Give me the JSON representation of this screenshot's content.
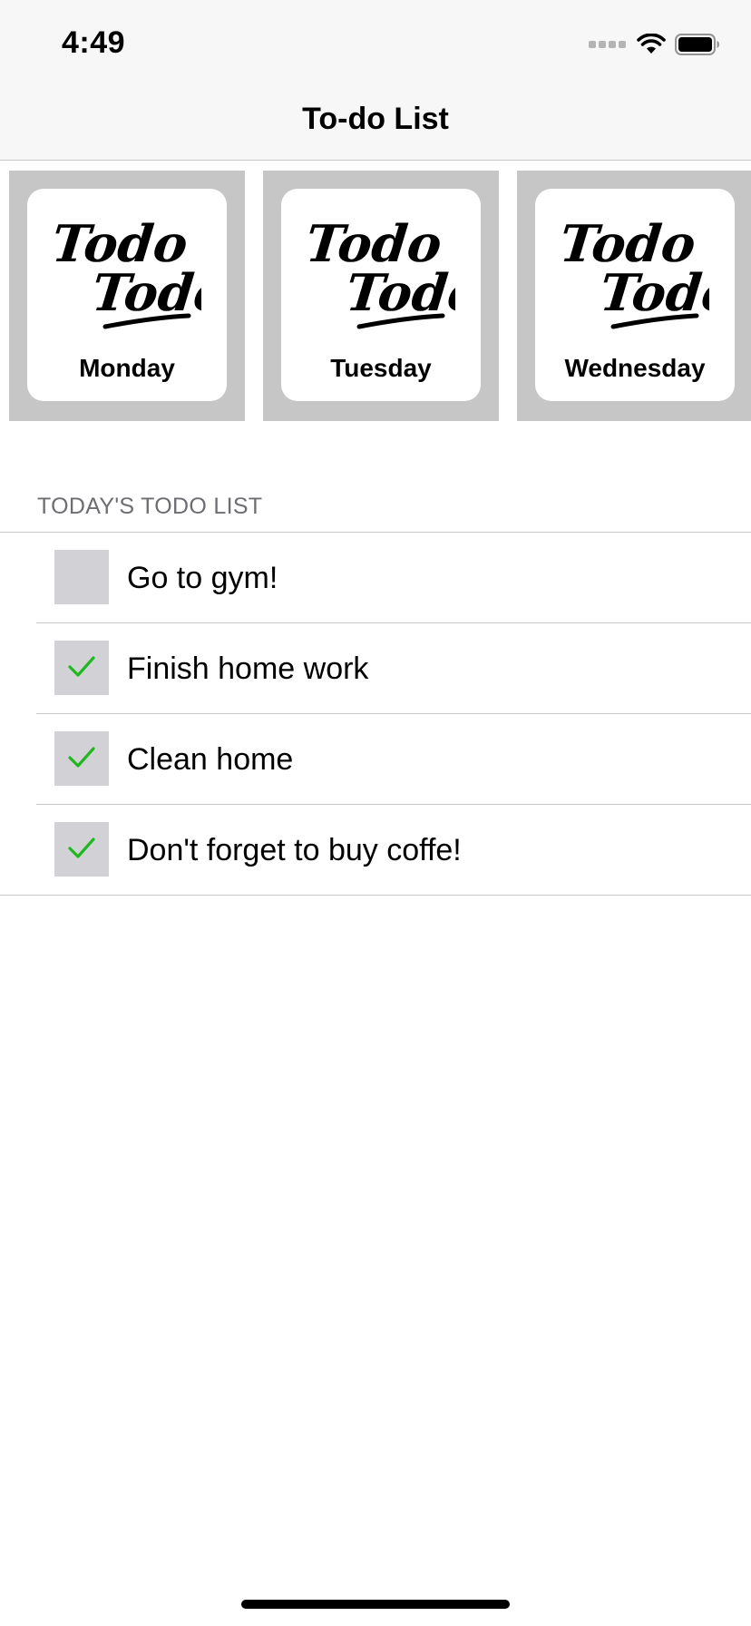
{
  "status_bar": {
    "time": "4:49",
    "icons": [
      "signal-icon",
      "wifi-icon",
      "battery-icon"
    ]
  },
  "nav": {
    "title": "To-do List"
  },
  "day_cards": [
    {
      "day": "Monday",
      "logo_text": "Todo Todo",
      "icon": "todo-logo"
    },
    {
      "day": "Tuesday",
      "logo_text": "Todo Todo",
      "icon": "todo-logo"
    },
    {
      "day": "Wednesday",
      "logo_text": "Todo Todo",
      "icon": "todo-logo"
    }
  ],
  "section": {
    "header": "TODAY'S TODO LIST"
  },
  "todos": [
    {
      "text": "Go to gym!",
      "done": false
    },
    {
      "text": "Finish home work",
      "done": true
    },
    {
      "text": "Clean home",
      "done": true
    },
    {
      "text": "Don't forget to buy coffe!",
      "done": true
    }
  ],
  "colors": {
    "check": "#21b81f",
    "checkbox_bg": "#d1d1d6",
    "card_bg": "#c6c6c6",
    "nav_bg": "#f7f7f7",
    "section_header": "#6d6d72"
  }
}
